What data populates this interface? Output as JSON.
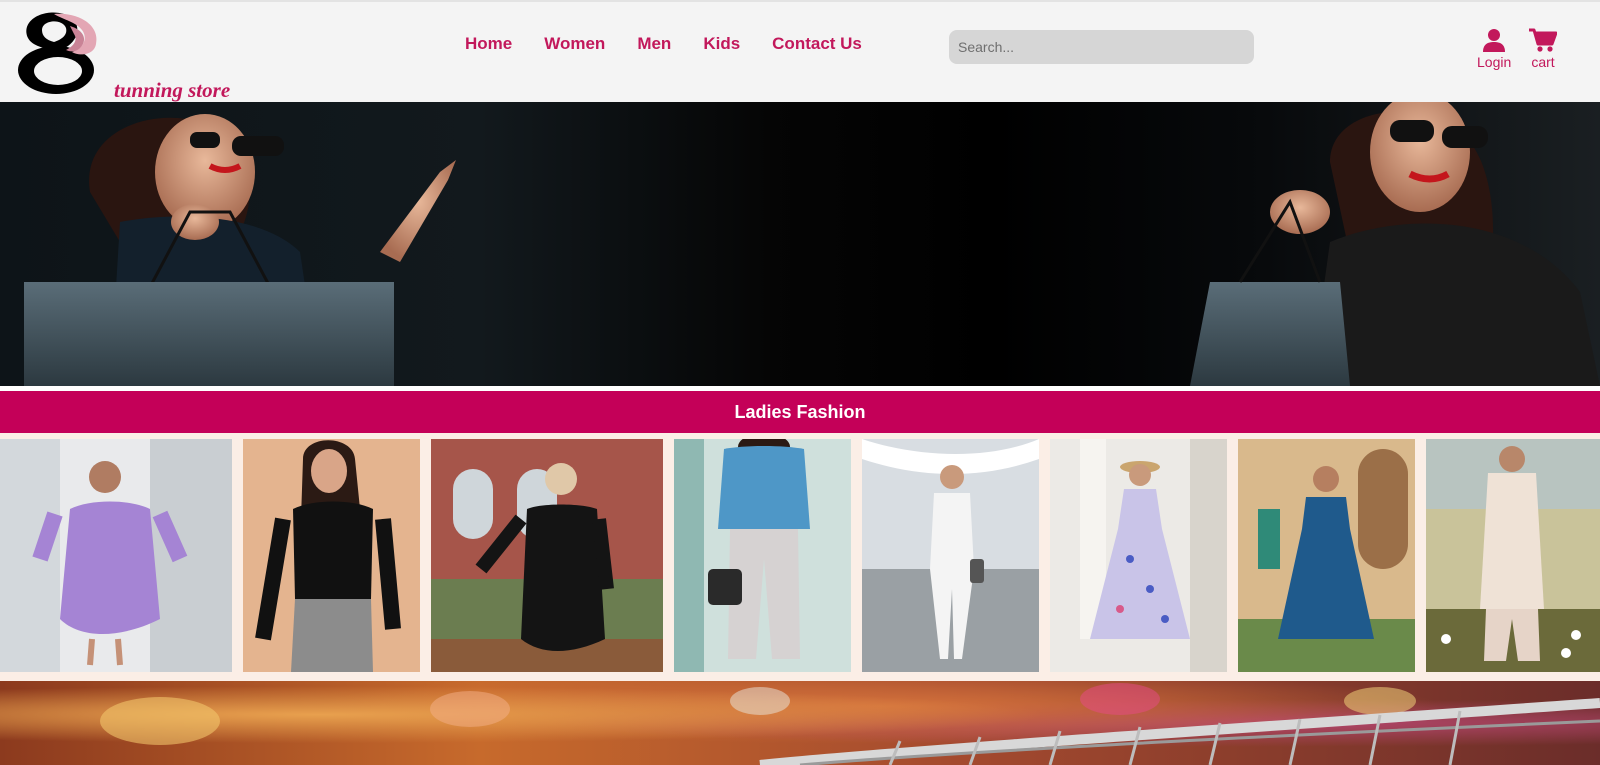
{
  "brand": {
    "logo_text": "tunning store"
  },
  "nav": [
    "Home",
    "Women",
    "Men",
    "Kids",
    "Contact Us"
  ],
  "search": {
    "placeholder": "Search...",
    "value": ""
  },
  "account": {
    "login_label": "Login",
    "cart_label": "cart"
  },
  "section": {
    "title": "Ladies Fashion"
  },
  "products": [
    {
      "name": "lavender-lace-dress"
    },
    {
      "name": "black-zip-top"
    },
    {
      "name": "black-lace-dress"
    },
    {
      "name": "blue-blouse-trousers"
    },
    {
      "name": "white-jumpsuit"
    },
    {
      "name": "floral-maxi-dress"
    },
    {
      "name": "blue-print-dress"
    },
    {
      "name": "ivory-kurta-set"
    }
  ],
  "colors": {
    "accent": "#c2185b",
    "section_bar": "#c40058",
    "header_bg": "#f4f4f4",
    "strip_bg": "#fbeee6"
  }
}
